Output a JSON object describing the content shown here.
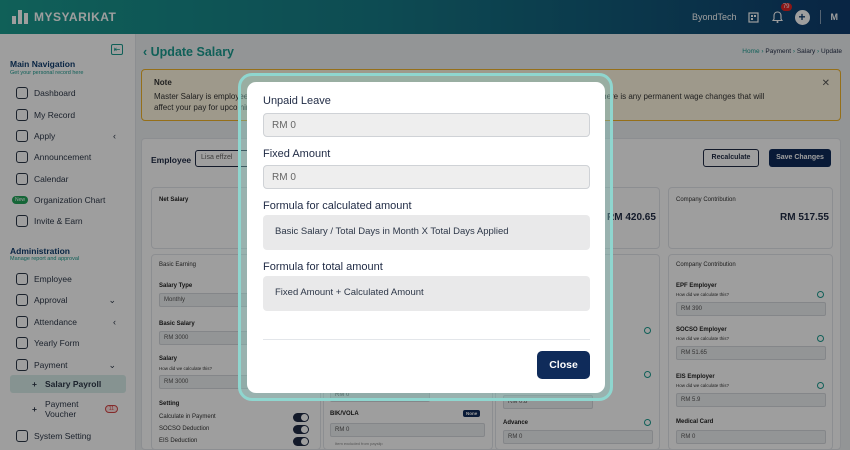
{
  "app": {
    "name": "MYSYARIKAT",
    "company": "ByondTech",
    "notif_count": "79",
    "avatar_text": "M"
  },
  "sidebar": {
    "main_title": "Main Navigation",
    "main_sub": "Get your personal record here",
    "items": [
      {
        "label": "Dashboard"
      },
      {
        "label": "My Record"
      },
      {
        "label": "Apply"
      },
      {
        "label": "Announcement"
      },
      {
        "label": "Calendar"
      },
      {
        "label": "Organization Chart",
        "badge": "New"
      },
      {
        "label": "Invite & Earn"
      }
    ],
    "admin_title": "Administration",
    "admin_sub": "Manage report and approval",
    "admin_items": [
      {
        "label": "Employee"
      },
      {
        "label": "Approval"
      },
      {
        "label": "Attendance"
      },
      {
        "label": "Yearly Form"
      },
      {
        "label": "Payment"
      }
    ],
    "sub_items": [
      {
        "label": "Salary Payroll"
      },
      {
        "label": "Payment Voucher",
        "badge": "11"
      }
    ],
    "bottom_item": "System Setting"
  },
  "page": {
    "title": "Update Salary",
    "breadcrumbs": [
      "Home",
      "Payment",
      "Salary",
      "Update"
    ],
    "note_title": "Note",
    "note_text_1": "Master Salary is employee",
    "note_text_1b": "ary. If there is any permanent wage changes that will",
    "note_text_2": "affect your pay for upcoming",
    "employee_label": "Employee",
    "employee_value": "Lisa effzel",
    "recalculate": "Recalculate",
    "save": "Save Changes",
    "net_salary_label": "Net Salary",
    "net_amount_partial": "RM 420.65",
    "company_contrib_label": "Company Contribution",
    "company_contrib_amount": "RM 517.55",
    "basic_earning": "Basic Earning",
    "salary_type_label": "Salary Type",
    "salary_type_value": "Monthly",
    "basic_salary_label": "Basic Salary",
    "basic_salary_value": "RM 3000",
    "salary_label": "Salary",
    "how_calc": "How did we calculate this?",
    "salary_value": "RM 3000",
    "setting_label": "Setting",
    "calc_in_payment": "Calculate in Payment",
    "socso_deduction": "SOCSO Deduction",
    "eis_deduction": "EIS Deduction",
    "rm0": "RM 0",
    "bik_label": "BIK/VOLA",
    "bik_badge": "None",
    "bik_value": "RM 0",
    "bik_note": "Item excluded from payslip",
    "advance_label": "Advance",
    "advance_value": "RM 0",
    "rm08": "RM 0.8",
    "company_contrib_section": "Company Contribution",
    "epf_label": "EPF Employer",
    "epf_value": "RM 390",
    "socso_label": "SOCSO Employer",
    "socso_value": "RM 51.65",
    "eis_label": "EIS Employer",
    "eis_value": "RM 5.9",
    "medical_label": "Medical Card",
    "medical_value": "RM 0"
  },
  "modal": {
    "unpaid_leave_label": "Unpaid Leave",
    "unpaid_leave_placeholder": "RM 0",
    "fixed_amount_label": "Fixed Amount",
    "fixed_amount_placeholder": "RM 0",
    "formula_calc_label": "Formula for calculated amount",
    "formula_calc_value": "Basic Salary / Total Days in Month X Total Days Applied",
    "formula_total_label": "Formula for total amount",
    "formula_total_value": "Fixed Amount + Calculated Amount",
    "close_label": "Close"
  }
}
